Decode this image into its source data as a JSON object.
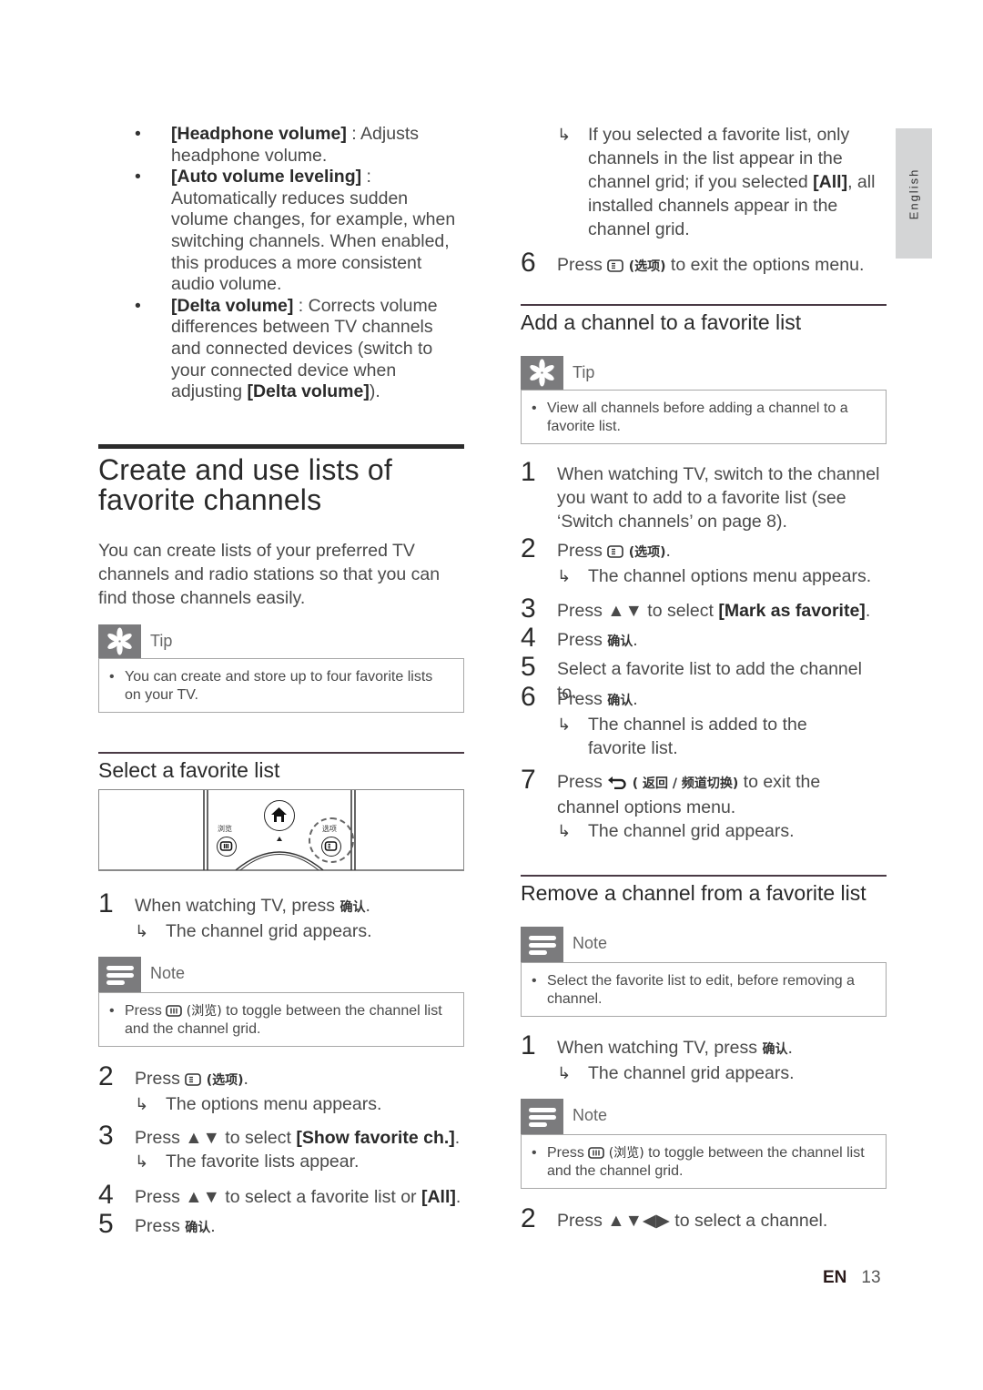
{
  "side_tab": {
    "label": "English"
  },
  "left": {
    "audio_bullets": [
      {
        "term": "[Headphone volume]",
        "desc": " : Adjusts headphone volume."
      },
      {
        "term": "[Auto volume leveling]",
        "desc": " : Automatically reduces sudden volume changes, for example, when switching channels. When enabled, this produces a more consistent audio volume."
      },
      {
        "term": "[Delta volume]",
        "desc": " : Corrects volume differences between TV channels and connected devices (switch to your connected device when adjusting ",
        "term2": "[Delta volume]",
        "tail": ")."
      }
    ],
    "section_title_line1": "Create and use lists of",
    "section_title_line2": "favorite channels",
    "intro": "You can create lists of your preferred TV channels and radio stations so that you can find those channels easily.",
    "tip": {
      "label": "Tip",
      "text": "You can create and store up to four favorite lists on your TV."
    },
    "subsection_title": "Select a favorite list",
    "remote": {
      "browse_label": "浏览",
      "options_label": "选项"
    },
    "steps": [
      {
        "num": "1",
        "text_before": "When watching TV, press ",
        "key": "确认",
        "text_after": ".",
        "result": "The channel grid appears."
      },
      {
        "num": "2",
        "text_before": "Press ",
        "key": "(选项)",
        "text_after": ".",
        "result": "The options menu appears."
      },
      {
        "num": "3",
        "text_before": "Press ▲▼ to select ",
        "key": "[Show favorite ch.]",
        "text_after": ".",
        "result": "The favorite lists appear."
      },
      {
        "num": "4",
        "text_before": "Press ▲▼ to select a favorite list or ",
        "key": "[All]",
        "text_after": "."
      },
      {
        "num": "5",
        "text_before": "Press ",
        "key": "确认",
        "text_after": "."
      }
    ],
    "note": {
      "label": "Note",
      "text_before": "Press ",
      "key": "(浏览)",
      "text_after": "  to toggle between the channel list and the channel grid."
    }
  },
  "right": {
    "result_cont": {
      "text_before": "If you selected a favorite list, only channels in the list appear in the channel grid; if you selected ",
      "key": "[All]",
      "text_after": ", all installed channels appear in the channel grid."
    },
    "step6": {
      "num": "6",
      "text_before": "Press ",
      "key": "(选项)",
      "text_after": " to exit the options menu."
    },
    "add_title": "Add a channel to a favorite list",
    "add_tip": {
      "label": "Tip",
      "text": "View all channels before adding a channel to a favorite list."
    },
    "add_steps": [
      {
        "num": "1",
        "text": "When watching TV, switch to the channel you want to add to a favorite list (see ‘Switch channels’ on page 8)."
      },
      {
        "num": "2",
        "text_before": "Press ",
        "key": "(选项)",
        "text_after": ".",
        "result": "The channel options menu appears."
      },
      {
        "num": "3",
        "text_before": "Press ▲▼ to select ",
        "key": "[Mark as favorite]",
        "text_after": "."
      },
      {
        "num": "4",
        "text_before": "Press ",
        "key": "确认",
        "text_after": "."
      },
      {
        "num": "5",
        "text": "Select a favorite list to add the channel to."
      },
      {
        "num": "6",
        "text_before": "Press ",
        "key": "确认",
        "text_after": ".",
        "result": "The channel is added to the favorite list."
      },
      {
        "num": "7",
        "text_before": "Press ",
        "key": "( 返回 / 频道切换)",
        "text_after": " to exit the channel options menu.",
        "result": "The channel grid appears."
      }
    ],
    "remove_title": "Remove a channel from a favorite list",
    "remove_note1": {
      "label": "Note",
      "text": "Select the favorite list to edit, before removing a channel."
    },
    "remove_steps": [
      {
        "num": "1",
        "text_before": "When watching TV, press ",
        "key": "确认",
        "text_after": ".",
        "result": "The channel grid appears."
      },
      {
        "num": "2",
        "text": "Press ▲▼◀▶ to select a channel."
      }
    ],
    "remove_note2": {
      "label": "Note",
      "text_before": "Press ",
      "key": "(浏览)",
      "text_after": "  to toggle between the channel list and the channel grid."
    }
  },
  "footer": {
    "lang": "EN",
    "page": "13"
  }
}
